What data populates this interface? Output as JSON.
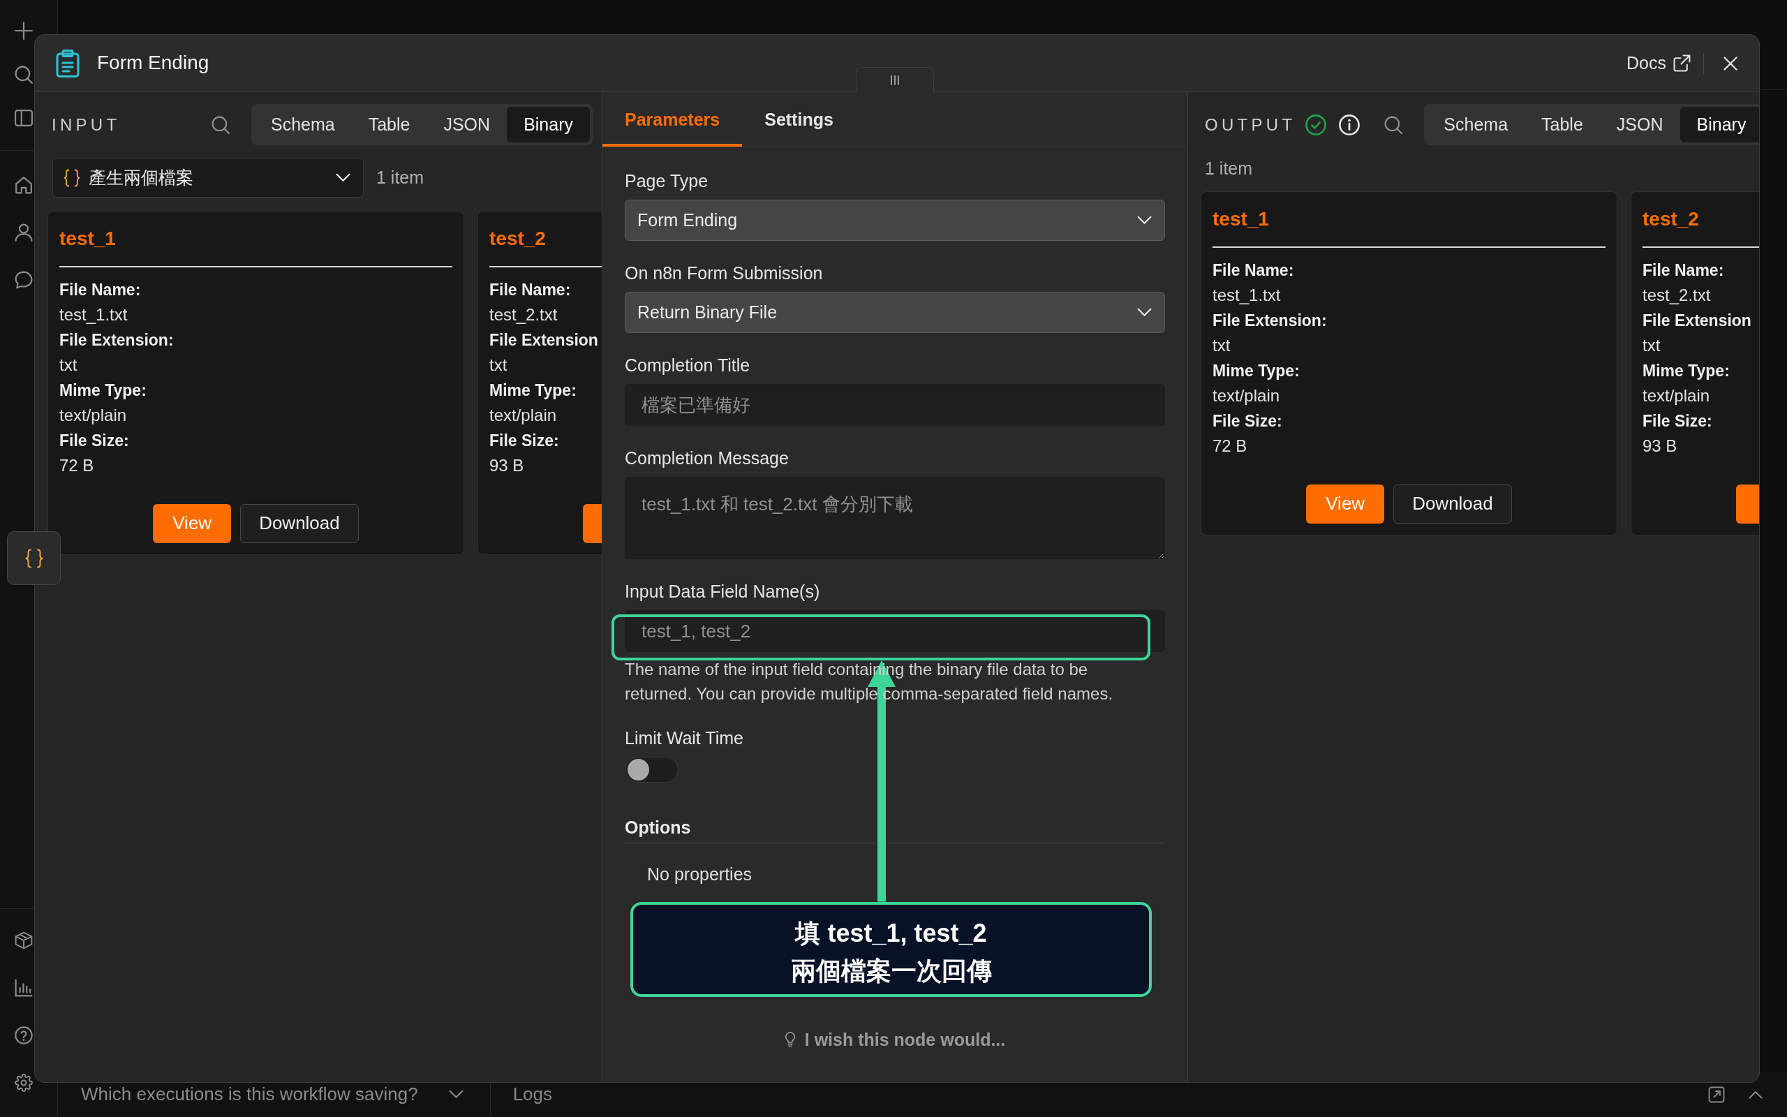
{
  "window": {
    "title": "Form Ending",
    "docs_link": "Docs"
  },
  "input_panel": {
    "heading": "INPUT",
    "view_tabs": [
      {
        "label": "Schema",
        "selected": false
      },
      {
        "label": "Table",
        "selected": false
      },
      {
        "label": "JSON",
        "selected": false
      },
      {
        "label": "Binary",
        "selected": true
      }
    ],
    "node_select": {
      "value": "產生兩個檔案"
    },
    "item_count": "1 item",
    "files": [
      {
        "title": "test_1",
        "fields": [
          {
            "label": "File Name:",
            "value": "test_1.txt"
          },
          {
            "label": "File Extension:",
            "value": "txt"
          },
          {
            "label": "Mime Type:",
            "value": "text/plain"
          },
          {
            "label": "File Size:",
            "value": "72 B"
          }
        ],
        "buttons": [
          {
            "kind": "primary",
            "label": "View"
          },
          {
            "kind": "secondary",
            "label": "Download"
          }
        ]
      },
      {
        "title": "test_2",
        "fields": [
          {
            "label": "File Name:",
            "value": "test_2.txt"
          },
          {
            "label": "File Extension",
            "value": "txt"
          },
          {
            "label": "Mime Type:",
            "value": "text/plain"
          },
          {
            "label": "File Size:",
            "value": "93 B"
          }
        ],
        "buttons": [
          {
            "kind": "primary"
          }
        ]
      }
    ]
  },
  "parameters_panel": {
    "tabs": [
      {
        "label": "Parameters",
        "selected": true
      },
      {
        "label": "Settings",
        "selected": false
      }
    ],
    "fields": [
      {
        "kind": "select",
        "label": "Page Type",
        "value": "Form Ending",
        "highlighted": false
      },
      {
        "kind": "select",
        "label": "On n8n Form Submission",
        "value": "Return Binary File",
        "highlighted": false
      },
      {
        "kind": "text",
        "label": "Completion Title",
        "value": "檔案已準備好",
        "highlighted": false
      },
      {
        "kind": "textarea",
        "label": "Completion Message",
        "value": "test_1.txt 和 test_2.txt 會分別下載",
        "highlighted": false
      },
      {
        "kind": "text",
        "label": "Input Data Field Name(s)",
        "value": "test_1, test_2",
        "hint": "The name of the input field containing the binary file data to be returned. You can provide multiple comma-separated field names.",
        "highlighted": true
      },
      {
        "kind": "toggle",
        "label": "Limit Wait Time",
        "on": false,
        "highlighted": false
      },
      {
        "kind": "section",
        "label": "Options",
        "empty_text": "No properties",
        "highlighted": false
      }
    ],
    "callout": {
      "lines": [
        "填 test_1, test_2",
        "兩個檔案一次回傳"
      ]
    },
    "feedback_link": "I wish this node would..."
  },
  "output_panel": {
    "heading": "OUTPUT",
    "view_tabs": [
      {
        "label": "Schema",
        "selected": false
      },
      {
        "label": "Table",
        "selected": false
      },
      {
        "label": "JSON",
        "selected": false
      },
      {
        "label": "Binary",
        "selected": true
      }
    ],
    "item_count": "1 item",
    "files": [
      {
        "title": "test_1",
        "fields": [
          {
            "label": "File Name:",
            "value": "test_1.txt"
          },
          {
            "label": "File Extension:",
            "value": "txt"
          },
          {
            "label": "Mime Type:",
            "value": "text/plain"
          },
          {
            "label": "File Size:",
            "value": "72 B"
          }
        ],
        "buttons": [
          {
            "kind": "primary",
            "label": "View"
          },
          {
            "kind": "secondary",
            "label": "Download"
          }
        ]
      },
      {
        "title": "test_2",
        "fields": [
          {
            "label": "File Name:",
            "value": "test_2.txt"
          },
          {
            "label": "File Extension",
            "value": "txt"
          },
          {
            "label": "Mime Type:",
            "value": "text/plain"
          },
          {
            "label": "File Size:",
            "value": "93 B"
          }
        ],
        "buttons": [
          {
            "kind": "primary"
          }
        ]
      }
    ]
  },
  "status_bar": {
    "executions_dropdown": "Which executions is this workflow saving?",
    "logs_tab": "Logs"
  }
}
